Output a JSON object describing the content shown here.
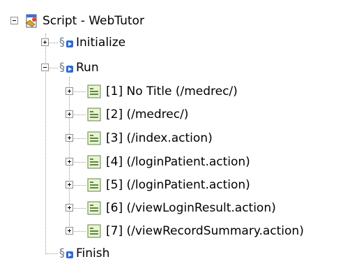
{
  "tree": {
    "root": {
      "label": "Script - WebTutor"
    },
    "initialize": {
      "label": "Initialize"
    },
    "run": {
      "label": "Run",
      "requests": [
        "[1] No Title (/medrec/)",
        "[2] (/medrec/)",
        "[3] (/index.action)",
        "[4] (/loginPatient.action)",
        "[5] (/loginPatient.action)",
        "[6] (/viewLoginResult.action)",
        "[7] (/viewRecordSummary.action)"
      ]
    },
    "finish": {
      "label": "Finish"
    }
  }
}
